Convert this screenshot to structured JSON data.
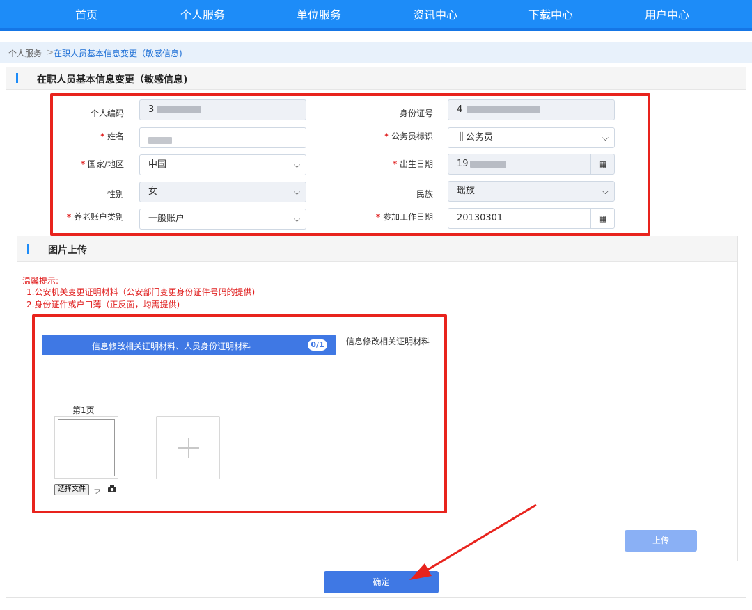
{
  "nav": {
    "items": [
      "首页",
      "个人服务",
      "单位服务",
      "资讯中心",
      "下载中心",
      "用户中心"
    ]
  },
  "breadcrumb": {
    "root": "个人服务",
    "separator": ">",
    "current": "在职人员基本信息变更（敏感信息)"
  },
  "form": {
    "title": "在职人员基本信息变更（敏感信息)",
    "personal_code_label": "个人编码",
    "personal_code_value": "3",
    "id_number_label": "身份证号",
    "id_number_value": "4",
    "name_label": "姓名",
    "civil_servant_label": "公务员标识",
    "civil_servant_value": "非公务员",
    "country_label": "国家/地区",
    "country_value": "中国",
    "birth_date_label": "出生日期",
    "birth_date_value": "19",
    "gender_label": "性别",
    "gender_value": "女",
    "ethnicity_label": "民族",
    "ethnicity_value": "瑶族",
    "pension_account_label": "养老账户类别",
    "pension_account_value": "一般账户",
    "work_start_label": "参加工作日期",
    "work_start_value": "20130301",
    "required_mark": "*"
  },
  "upload": {
    "title": "图片上传",
    "tip_heading": "温馨提示:",
    "tip_1": "1.公安机关变更证明材料（公安部门变更身份证件号码的提供)",
    "tip_2": "2.身份证件或户口薄（正反面，均需提供)",
    "category_label": "信息修改相关证明材料、人员身份证明材料",
    "category_count": "0/1",
    "side_label": "信息修改相关证明材料",
    "page_label": "第1页",
    "choose_file_label": "选择文件",
    "upload_button": "上传"
  },
  "confirm_button": "确定",
  "colors": {
    "nav_bg": "#1d8cf8",
    "primary_button": "#3f78e4",
    "annotation_red": "#e8231d",
    "tip_red": "#e02020"
  },
  "icons": {
    "calendar": "calendar-icon",
    "dropdown": "chevron-down-icon",
    "camera": "camera-icon",
    "plus": "plus-icon"
  }
}
